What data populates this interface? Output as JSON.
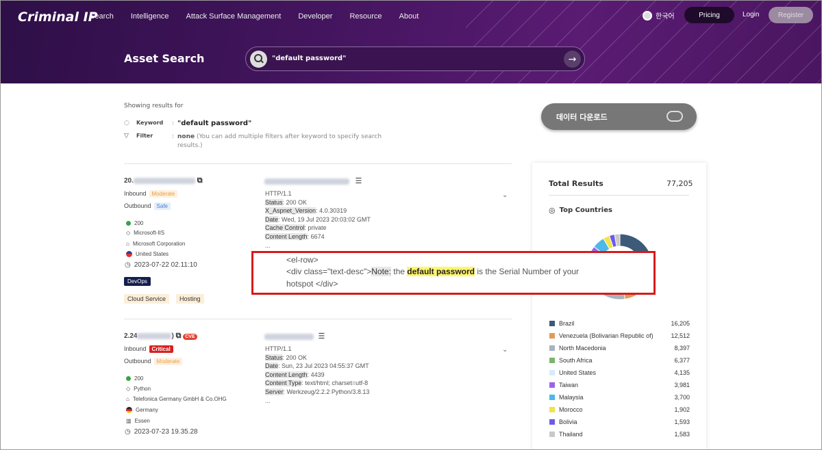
{
  "header": {
    "logo": "Criminal IP",
    "nav": [
      "Search",
      "Intelligence",
      "Attack Surface Management",
      "Developer",
      "Resource",
      "About"
    ],
    "lang": "한국어",
    "pricing": "Pricing",
    "login": "Login",
    "register": "Register",
    "page_title": "Asset Search",
    "search_query": "\"default password\""
  },
  "filters": {
    "showing": "Showing results for",
    "keyword_label": "Keyword",
    "keyword_value": "\"default password\"",
    "filter_label": "Filter",
    "filter_value": "none",
    "filter_hint": "(You can add multiple filters after keyword to specify search",
    "filter_hint2": "results.)"
  },
  "download_label": "데이터 다운로드",
  "results": [
    {
      "ip_prefix": "20.",
      "inbound_label": "Inbound",
      "inbound_tag": "Moderate",
      "outbound_label": "Outbound",
      "outbound_tag": "Safe",
      "status": "200",
      "server": "Microsoft-IIS",
      "org": "Microsoft Corporation",
      "country": "United States",
      "date": "2023-07-22 02.11:10",
      "tag_devops": "DevOps",
      "tags": [
        "Cloud Service",
        "Hosting"
      ],
      "http": {
        "l1": "HTTP/1.1",
        "k2": "Status",
        "v2": ": 200 OK",
        "k3": "X_Aspnet_Version",
        "v3": ": 4.0.30319",
        "k4": "Date",
        "v4": ": Wed, 19 Jul 2023 20:03:02 GMT",
        "k5": "Cache Control",
        "v5": ": private",
        "k6": "Content Length",
        "v6": ": 6674",
        "more": "..."
      }
    },
    {
      "ip_prefix": "2.24",
      "cve": "CVE",
      "inbound_label": "Inbound",
      "inbound_tag": "Critical",
      "outbound_label": "Outbound",
      "outbound_tag": "Moderate",
      "status": "200",
      "server": "Python",
      "org": "Telefonica Germany GmbH & Co.OHG",
      "country": "Germany",
      "city": "Essen",
      "date": "2023-07-23 19.35.28",
      "http": {
        "l1": "HTTP/1.1",
        "k2": "Status",
        "v2": ": 200 OK",
        "k3": "Date",
        "v3": ": Sun, 23 Jul 2023 04:55:37 GMT",
        "k4": "Content Length",
        "v4": ": 4439",
        "k5": "Content Type",
        "v5": ": text/html; charset=utf-8",
        "k6": "Server",
        "v6": ": Werkzeug/2.2.2 Python/3.8.13",
        "more": "..."
      }
    }
  ],
  "highlight": {
    "line1": "<el-row>",
    "line2a": "<div class=\"text-desc\">",
    "note": "Note:",
    "line2b": " the ",
    "hit": "default password",
    "line2c": " is the Serial Number of your",
    "line3": "hotspot </div>"
  },
  "stats": {
    "total_label": "Total Results",
    "total_value": "77,205",
    "top_countries": "Top Countries",
    "countries": [
      {
        "name": "Brazil",
        "count": "16,205",
        "color": "#3d5a78"
      },
      {
        "name": "Venezuela (Bolivarian Republic of)",
        "count": "12,512",
        "color": "#e39a55"
      },
      {
        "name": "North Macedonia",
        "count": "8,397",
        "color": "#a7b3bf"
      },
      {
        "name": "South Africa",
        "count": "6,377",
        "color": "#7cb56a"
      },
      {
        "name": "United States",
        "count": "4,135",
        "color": "#d6ecfb"
      },
      {
        "name": "Taiwan",
        "count": "3,981",
        "color": "#9b63e8"
      },
      {
        "name": "Malaysia",
        "count": "3,700",
        "color": "#4db9e8"
      },
      {
        "name": "Morocco",
        "count": "1,902",
        "color": "#f2e34a"
      },
      {
        "name": "Bolivia",
        "count": "1,593",
        "color": "#6c5ce7"
      },
      {
        "name": "Thailand",
        "count": "1,583",
        "color": "#c9c9c9"
      }
    ]
  }
}
